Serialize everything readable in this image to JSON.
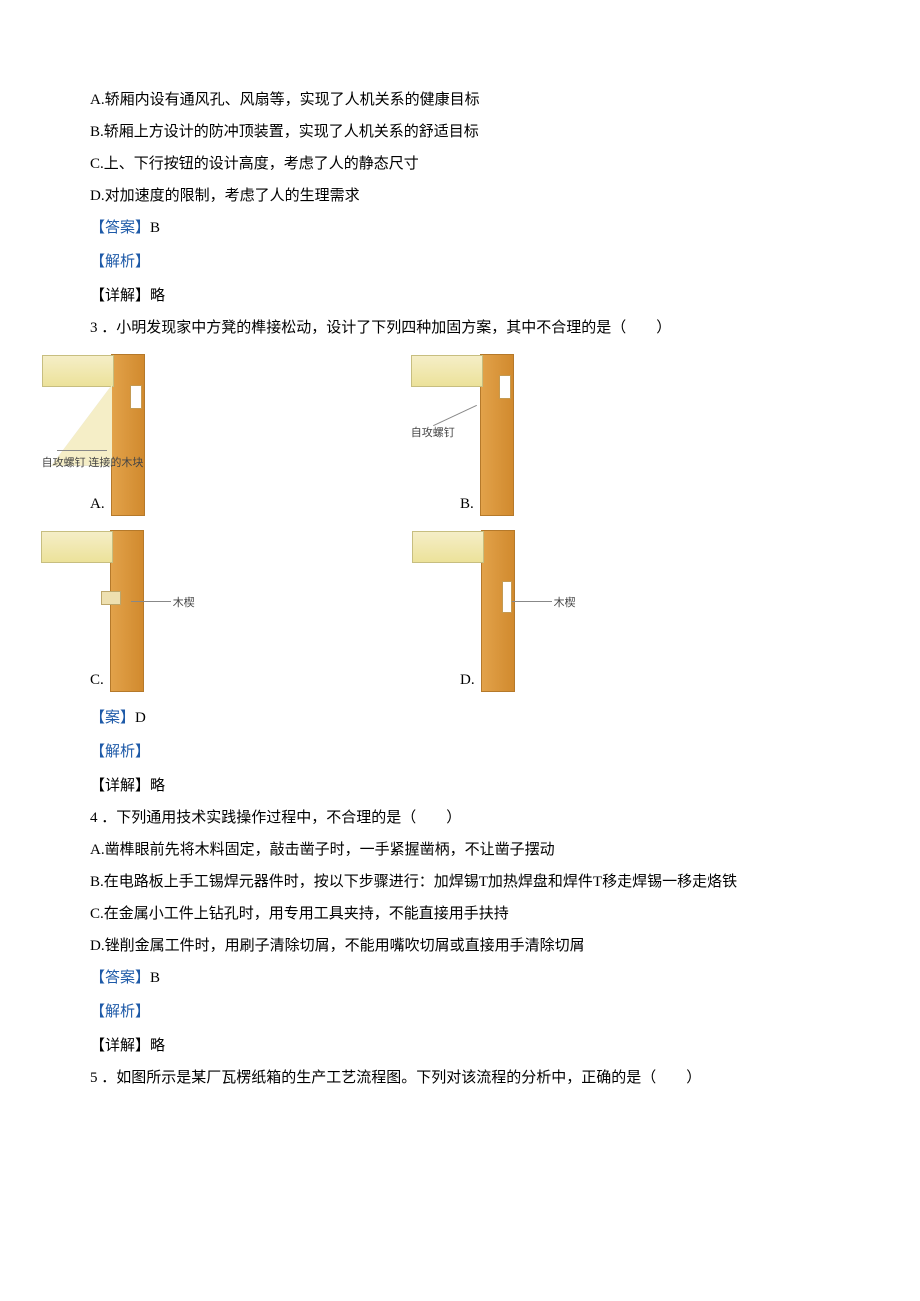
{
  "q2": {
    "optionA": "A.轿厢内设有通风孔、风扇等，实现了人机关系的健康目标",
    "optionB": "B.轿厢上方设计的防冲顶装置，实现了人机关系的舒适目标",
    "optionC": "C.上、下行按钮的设计高度，考虑了人的静态尺寸",
    "optionD": "D.对加速度的限制，考虑了人的生理需求",
    "answerLabel": "【答案】",
    "answerVal": "B",
    "analysis": "【解析】",
    "detail": "【详解】略"
  },
  "q3": {
    "stem": "3 ．小明发现家中方凳的榫接松动，设计了下列四种加固方案，其中不合理的是（　　）",
    "optA": "A.",
    "optB": "B.",
    "optC": "C.",
    "optD": "D.",
    "labelA": "自攻螺钉\n连接的木块",
    "labelB": "自攻螺钉",
    "labelC": "木楔",
    "labelD": "木楔",
    "answerLabel": "【案】",
    "answerVal": "D",
    "analysis": "【解析】",
    "detail": "【详解】略"
  },
  "q4": {
    "stem": "4 ．下列通用技术实践操作过程中，不合理的是（　　）",
    "optionA": "A.凿榫眼前先将木料固定，敲击凿子时，一手紧握凿柄，不让凿子摆动",
    "optionB": "B.在电路板上手工锡焊元器件时，按以下步骤进行：加焊锡T加热焊盘和焊件T移走焊锡一移走烙铁",
    "optionC": "C.在金属小工件上钻孔时，用专用工具夹持，不能直接用手扶持",
    "optionD": "D.锉削金属工件时，用刷子清除切屑，不能用嘴吹切屑或直接用手清除切屑",
    "answerLabel": "【答案】",
    "answerVal": "B",
    "analysis": "【解析】",
    "detail": "【详解】略"
  },
  "q5": {
    "stem": "5 ．如图所示是某厂瓦楞纸箱的生产工艺流程图。下列对该流程的分析中，正确的是（　　）"
  }
}
